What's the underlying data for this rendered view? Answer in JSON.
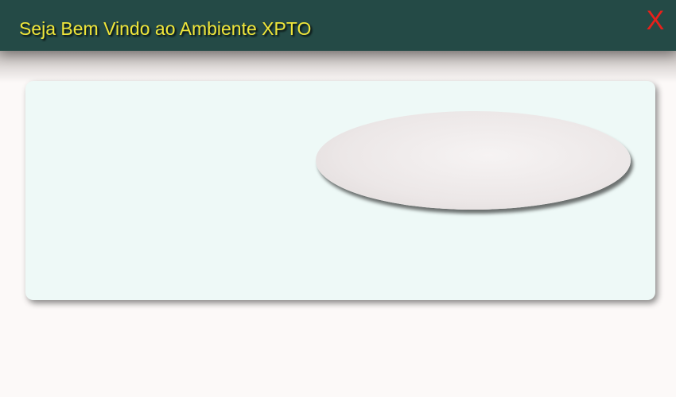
{
  "header": {
    "title": "Seja Bem Vindo ao Ambiente XPTO",
    "close_label": "X"
  },
  "colors": {
    "header_bg": "#244a46",
    "title_text": "#f0e63a",
    "close_text": "#e8201a",
    "panel_bg": "#eef9f7",
    "page_bg": "#fcf9f8"
  }
}
